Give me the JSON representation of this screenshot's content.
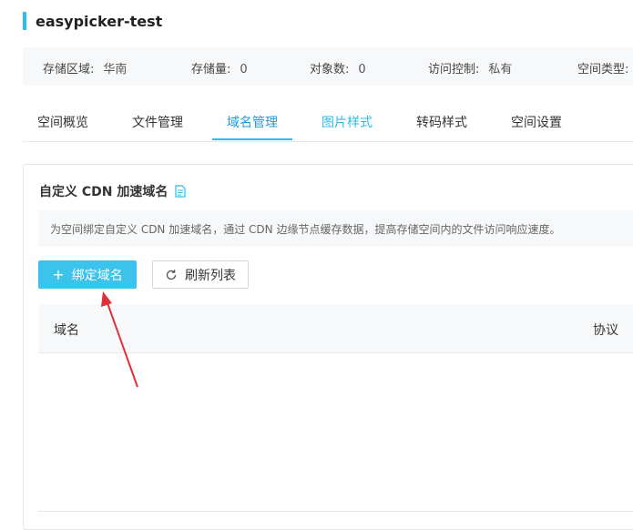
{
  "bucket": {
    "name": "easypicker-test"
  },
  "stats": [
    {
      "label": "存储区域:",
      "value": "华南"
    },
    {
      "label": "存储量:",
      "value": "0"
    },
    {
      "label": "对象数:",
      "value": "0"
    },
    {
      "label": "访问控制:",
      "value": "私有"
    },
    {
      "label": "空间类型:",
      "value": ""
    }
  ],
  "tabs": [
    {
      "label": "空间概览"
    },
    {
      "label": "文件管理"
    },
    {
      "label": "域名管理",
      "active": true
    },
    {
      "label": "图片样式"
    },
    {
      "label": "转码样式"
    },
    {
      "label": "空间设置"
    }
  ],
  "section": {
    "title": "自定义 CDN 加速域名",
    "notice": "为空间绑定自定义 CDN 加速域名，通过 CDN 边缘节点缓存数据，提高存储空间内的文件访问响应速度。",
    "bind_button": "绑定域名",
    "refresh_button": "刷新列表"
  },
  "table": {
    "columns": [
      "域名",
      "协议"
    ]
  },
  "colors": {
    "accent": "#2dbbe8",
    "arrow": "#e0303a"
  },
  "icons": {
    "doc": "document-icon",
    "plus": "plus-icon",
    "refresh": "refresh-icon"
  }
}
